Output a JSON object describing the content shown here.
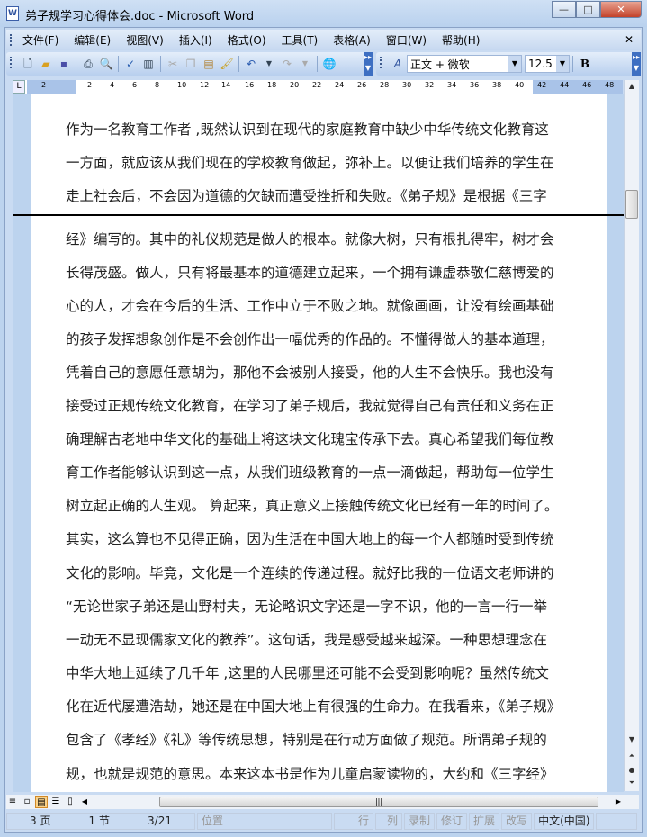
{
  "window": {
    "title": "弟子规学习心得体会.doc - Microsoft Word",
    "app_icon": "W"
  },
  "menu": [
    "文件(F)",
    "编辑(E)",
    "视图(V)",
    "插入(I)",
    "格式(O)",
    "工具(T)",
    "表格(A)",
    "窗口(W)",
    "帮助(H)"
  ],
  "toolbar": {
    "style": "正文 + 微软",
    "font_size": "12.5",
    "bold": "B"
  },
  "ruler": [
    "2",
    "2",
    "4",
    "6",
    "8",
    "10",
    "12",
    "14",
    "16",
    "18",
    "20",
    "22",
    "24",
    "26",
    "28",
    "30",
    "32",
    "34",
    "36",
    "38",
    "40",
    "42",
    "44",
    "46",
    "48"
  ],
  "document": {
    "lines": [
      "作为一名教育工作者 ,既然认识到在现代的家庭教育中缺少中华传统文化教育这",
      "一方面，就应该从我们现在的学校教育做起，弥补上。以便让我们培养的学生在",
      "走上社会后，不会因为道德的欠缺而遭受挫折和失败。《弟子规》是根据《三字",
      "经》编写的。其中的礼仪规范是做人的根本。就像大树，只有根扎得牢，树才会",
      "长得茂盛。做人，只有将最基本的道德建立起来，一个拥有谦虚恭敬仁慈博爱的",
      "心的人，才会在今后的生活、工作中立于不败之地。就像画画，让没有绘画基础",
      "的孩子发挥想象创作是不会创作出一幅优秀的作品的。不懂得做人的基本道理，",
      "凭着自己的意愿任意胡为，那他不会被别人接受，他的人生不会快乐。我也没有",
      "接受过正规传统文化教育，在学习了弟子规后，我就觉得自己有责任和义务在正",
      "确理解古老地中华文化的基础上将这块文化瑰宝传承下去。真心希望我们每位教",
      "育工作者能够认识到这一点，从我们班级教育的一点一滴做起，帮助每一位学生",
      "树立起正确的人生观。 算起来，真正意义上接触传统文化已经有一年的时间了。",
      "其实，这么算也不见得正确，因为生活在中国大地上的每一个人都随时受到传统",
      "文化的影响。毕竟，文化是一个连续的传递过程。就好比我的一位语文老师讲的",
      "“无论世家子弟还是山野村夫，无论略识文字还是一字不识，他的一言一行一举",
      "一动无不显现儒家文化的教养”。这句话，我是感受越来越深。一种思想理念在",
      "中华大地上延续了几千年 ,这里的人民哪里还可能不会受到影响呢？虽然传统文",
      "化在近代屡遭浩劫，她还是在中国大地上有很强的生命力。在我看来，《弟子规》",
      "包含了《孝经》《礼》等传统思想，特别是在行动方面做了规范。所谓弟子规的",
      "规，也就是规范的意思。本来这本书是作为儿童启蒙读物的，大约和《三字经》"
    ]
  },
  "status": {
    "page": "3 页",
    "section": "1 节",
    "pages": "3/21",
    "position": "位置",
    "row": "行",
    "col": "列",
    "rec": "录制",
    "trk": "修订",
    "ext": "扩展",
    "ovr": "改写",
    "lang": "中文(中国)"
  }
}
